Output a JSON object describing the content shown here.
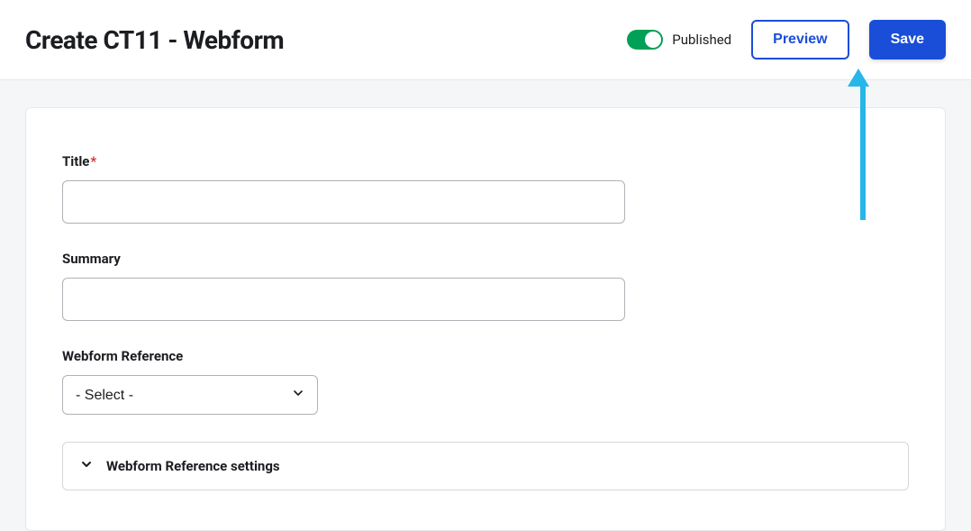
{
  "header": {
    "title": "Create CT11 - Webform",
    "published_label": "Published",
    "preview_label": "Preview",
    "save_label": "Save"
  },
  "form": {
    "title": {
      "label": "Title",
      "required_mark": "*",
      "value": ""
    },
    "summary": {
      "label": "Summary",
      "value": ""
    },
    "webform_reference": {
      "label": "Webform Reference",
      "selected": "- Select -"
    },
    "settings_panel": {
      "label": "Webform Reference settings"
    }
  }
}
